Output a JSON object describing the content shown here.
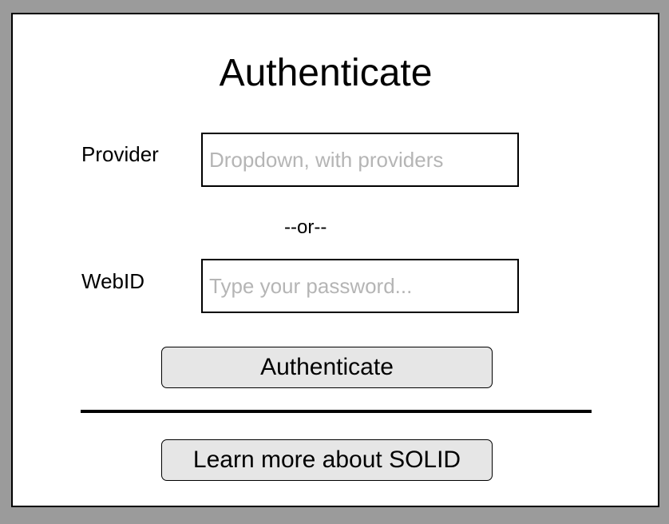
{
  "dialog": {
    "title": "Authenticate",
    "provider": {
      "label": "Provider",
      "placeholder": "Dropdown, with providers"
    },
    "separator_text": "--or--",
    "webid": {
      "label": "WebID",
      "placeholder": "Type your password..."
    },
    "authenticate_button": "Authenticate",
    "learn_more_button": "Learn more about SOLID"
  }
}
